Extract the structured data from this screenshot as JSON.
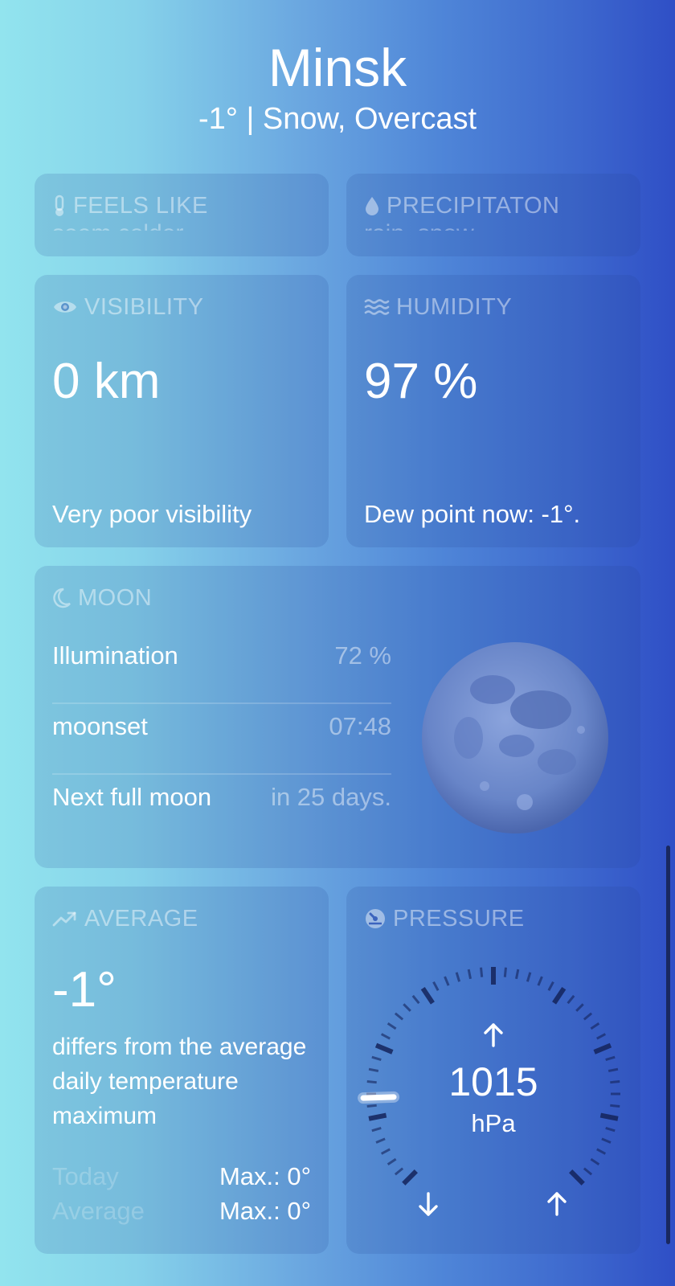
{
  "header": {
    "city": "Minsk",
    "summary": "-1° | Snow, Overcast"
  },
  "feels_like": {
    "title": "FEELS LIKE",
    "partial_text": "seem colder",
    "icon": "thermometer-icon"
  },
  "precipitation": {
    "title": "PRECIPITATON",
    "partial_text": "rain, snow",
    "icon": "droplet-icon"
  },
  "visibility": {
    "title": "VISIBILITY",
    "value": "0 km",
    "description": "Very poor visibility",
    "icon": "eye-icon"
  },
  "humidity": {
    "title": "HUMIDITY",
    "value": "97 %",
    "description": "Dew point now: -1°.",
    "icon": "waves-icon"
  },
  "moon": {
    "title": "MOON",
    "icon": "crescent-moon-icon",
    "rows": [
      {
        "label": "Illumination",
        "value": "72 %"
      },
      {
        "label": "moonset",
        "value": "07:48"
      },
      {
        "label": "Next full moon",
        "value": "in 25 days."
      }
    ],
    "illumination_fraction": 0.72
  },
  "average": {
    "title": "AVERAGE",
    "icon": "trend-up-icon",
    "value": "-1°",
    "description": "differs from the average daily temperature maximum",
    "rows": [
      {
        "label": "Today",
        "value": "Max.: 0°"
      },
      {
        "label": "Average",
        "value": "Max.: 0°"
      }
    ]
  },
  "pressure": {
    "title": "PRESSURE",
    "icon": "gauge-icon",
    "value": "1015",
    "unit": "hPa",
    "trend_icon": "arrow-up-icon",
    "low_icon": "arrow-down-icon",
    "high_icon": "arrow-up-icon",
    "gauge_fraction": 0.16
  },
  "colors": {
    "gradient_left": "#92e4ee",
    "gradient_right": "#2f4fc6"
  }
}
